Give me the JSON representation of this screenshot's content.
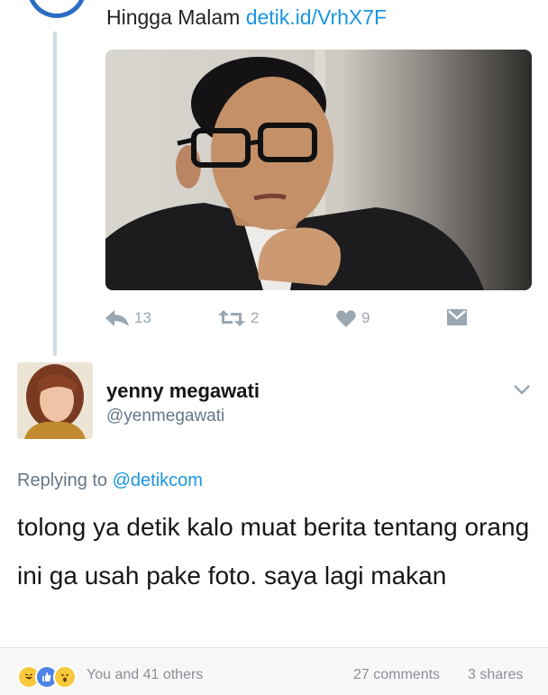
{
  "tweet_top": {
    "text_prefix": "Hingga Malam",
    "link": "detik.id/VrhX7F",
    "actions": {
      "reply_count": "13",
      "retweet_count": "2",
      "like_count": "9"
    }
  },
  "reply_tweet": {
    "display_name": "yenny megawati",
    "handle": "@yenmegawati",
    "replying_label": "Replying to",
    "replying_mention": "@detikcom",
    "text": "tolong ya detik kalo muat berita tentang orang ini ga usah pake foto. saya lagi makan"
  },
  "fb_footer": {
    "reactions_text": "You and 41 others",
    "comments": "27 comments",
    "shares": "3 shares"
  },
  "colors": {
    "link_blue": "#1b95e0",
    "icon_gray": "#9aa7b1",
    "thread_line": "#cfdbe4"
  }
}
